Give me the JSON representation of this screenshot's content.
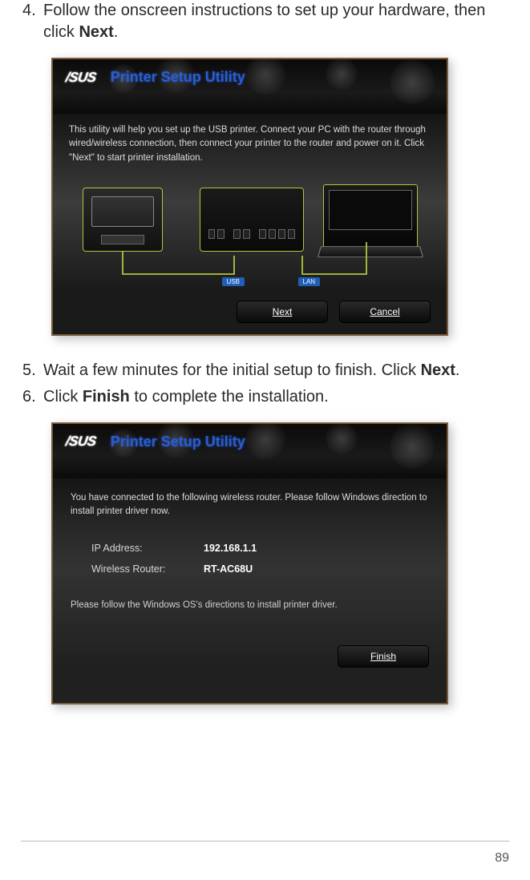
{
  "steps": {
    "s4": {
      "num": "4.",
      "text_a": "Follow the onscreen instructions to set up your hardware, then click ",
      "bold": "Next",
      "text_b": "."
    },
    "s5": {
      "num": "5.",
      "text_a": "Wait a few minutes for the initial setup to finish. Click ",
      "bold": "Next",
      "text_b": "."
    },
    "s6": {
      "num": "6.",
      "text_a": "Click ",
      "bold": "Finish",
      "text_b": " to complete the installation."
    }
  },
  "screenshot1": {
    "brand": "/SUS",
    "title": "Printer Setup Utility",
    "instruction": "This utility will help you set up the USB printer. Connect your PC with the router through wired/wireless connection, then connect your printer to the router and power on it. Click \"Next\" to start printer installation.",
    "tags": {
      "usb": "USB",
      "lan": "LAN"
    },
    "buttons": {
      "next": "Next",
      "cancel": "Cancel"
    }
  },
  "screenshot2": {
    "brand": "/SUS",
    "title": "Printer Setup Utility",
    "instruction": "You have connected to the following wireless router. Please follow Windows direction to install printer driver now.",
    "fields": {
      "ip_label": "IP Address:",
      "ip_value": "192.168.1.1",
      "router_label": "Wireless Router:",
      "router_value": "RT-AC68U"
    },
    "note": "Please follow the Windows OS's directions to install printer driver.",
    "buttons": {
      "finish": "Finish"
    }
  },
  "page_number": "89"
}
